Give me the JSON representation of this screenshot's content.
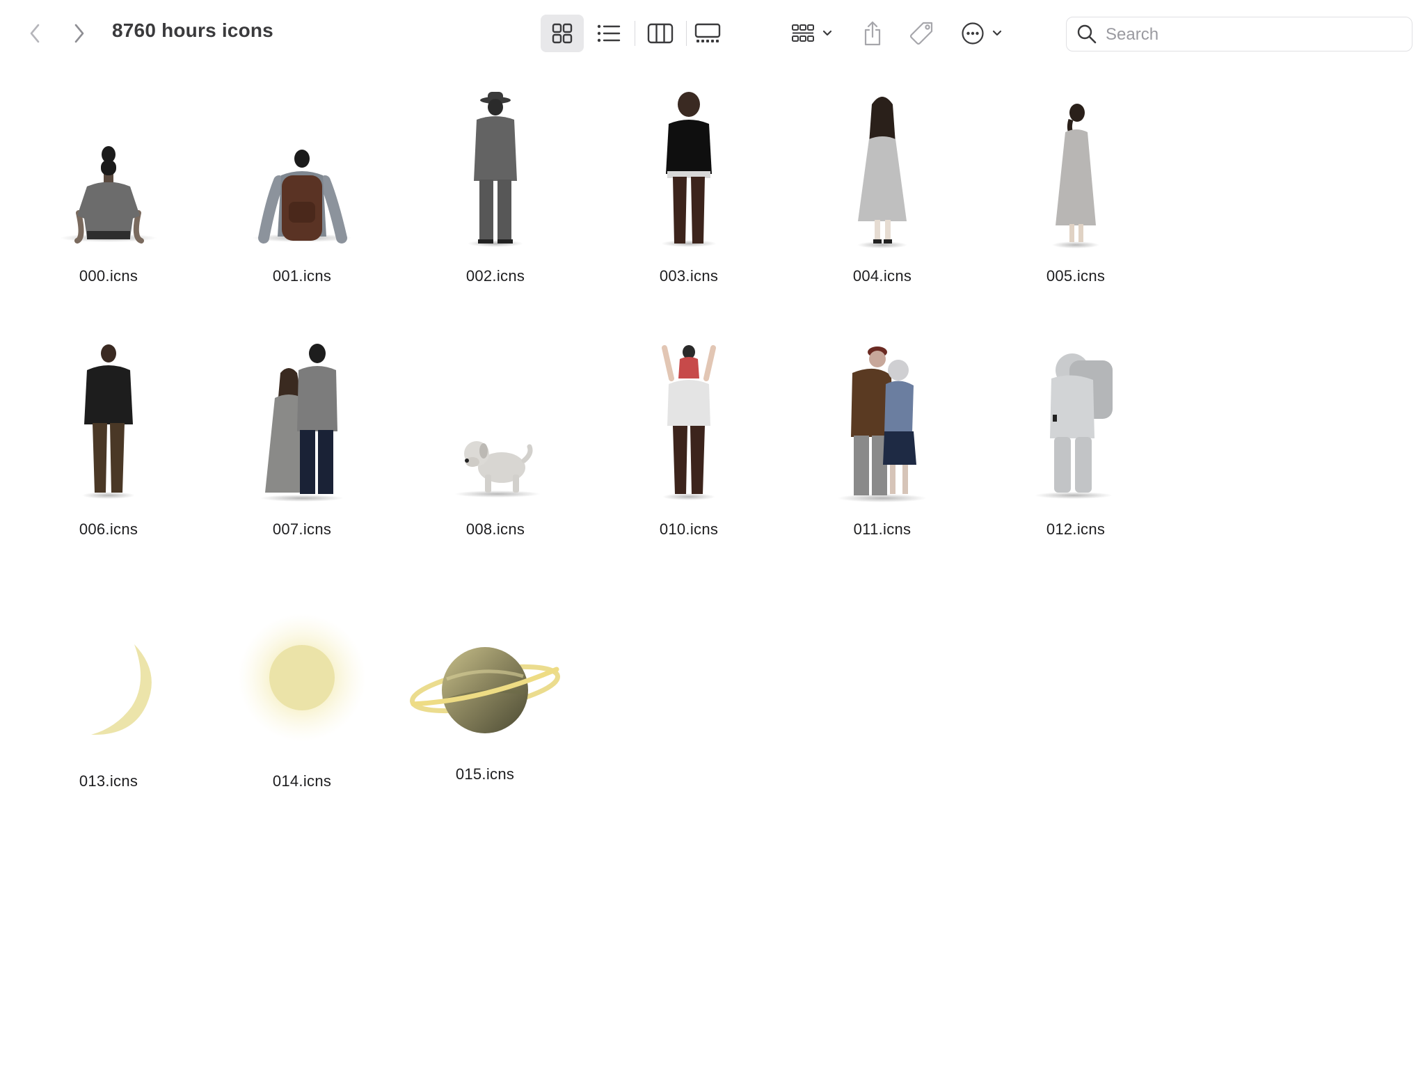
{
  "window": {
    "title": "8760 hours icons"
  },
  "toolbar": {
    "back_icon": "chevron-left-icon",
    "forward_icon": "chevron-right-icon",
    "view_modes": [
      "icon-view-icon",
      "list-view-icon",
      "column-view-icon",
      "gallery-view-icon"
    ],
    "active_view": "icon-view-icon",
    "group_icon": "group-by-icon",
    "share_icon": "share-icon",
    "tag_icon": "tag-icon",
    "more_icon": "more-actions-icon"
  },
  "search": {
    "placeholder": "Search",
    "value": ""
  },
  "files": [
    {
      "name": "000.icns",
      "icon": "person-sitting-icon"
    },
    {
      "name": "001.icns",
      "icon": "person-with-backpack-icon"
    },
    {
      "name": "002.icns",
      "icon": "man-with-hat-icon"
    },
    {
      "name": "003.icns",
      "icon": "woman-black-sweater-icon"
    },
    {
      "name": "004.icns",
      "icon": "woman-long-hair-dress-icon"
    },
    {
      "name": "005.icns",
      "icon": "woman-ponytail-dress-icon"
    },
    {
      "name": "006.icns",
      "icon": "man-black-jacket-icon"
    },
    {
      "name": "007.icns",
      "icon": "couple-icon"
    },
    {
      "name": "008.icns",
      "icon": "dog-icon"
    },
    {
      "name": "010.icns",
      "icon": "father-carrying-child-icon"
    },
    {
      "name": "011.icns",
      "icon": "elderly-couple-icon"
    },
    {
      "name": "012.icns",
      "icon": "astronaut-icon"
    },
    {
      "name": "013.icns",
      "icon": "crescent-moon-icon"
    },
    {
      "name": "014.icns",
      "icon": "sun-icon"
    },
    {
      "name": "015.icns",
      "icon": "saturn-planet-icon"
    }
  ]
}
